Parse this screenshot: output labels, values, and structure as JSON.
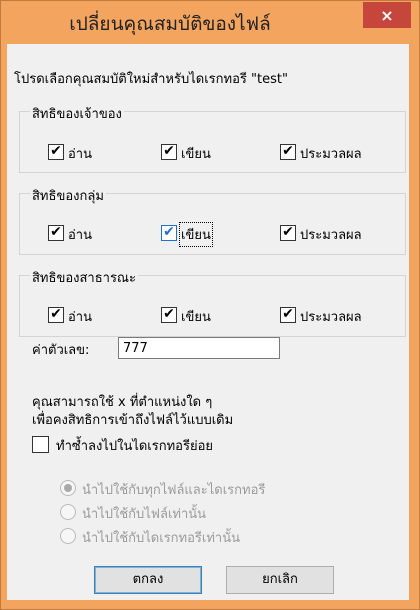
{
  "window": {
    "title": "เปลี่ยนคุณสมบัติของไฟล์",
    "close_icon": "×"
  },
  "prompt": "โปรดเลือกคุณสมบัติใหม่สำหรับไดเรกทอรี \"test\"",
  "groups": [
    {
      "label": "สิทธิของเจ้าของ",
      "read": {
        "label": "อ่าน",
        "checked": true
      },
      "write": {
        "label": "เขียน",
        "checked": true
      },
      "execute": {
        "label": "ประมวลผล",
        "checked": true
      }
    },
    {
      "label": "สิทธิของกลุ่ม",
      "read": {
        "label": "อ่าน",
        "checked": true
      },
      "write": {
        "label": "เขียน",
        "checked": true
      },
      "execute": {
        "label": "ประมวลผล",
        "checked": true
      }
    },
    {
      "label": "สิทธิของสาธารณะ",
      "read": {
        "label": "อ่าน",
        "checked": true
      },
      "write": {
        "label": "เขียน",
        "checked": true
      },
      "execute": {
        "label": "ประมวลผล",
        "checked": true
      }
    }
  ],
  "numeric": {
    "label": "ค่าตัวเลข:",
    "value": "777"
  },
  "hint_line1": "คุณสามารถใช้ x ที่ตำแหน่งใด ๆ",
  "hint_line2": "เพื่อคงสิทธิการเข้าถึงไฟล์ไว้แบบเดิม",
  "recursive": {
    "label": "ทำซ้ำลงไปในไดเรกทอรีย่อย",
    "checked": false
  },
  "apply_options": [
    {
      "label": "นำไปใช้กับทุกไฟล์และไดเรกทอรี",
      "selected": true
    },
    {
      "label": "นำไปใช้กับไฟล์เท่านั้น",
      "selected": false
    },
    {
      "label": "นำไปใช้กับไดเรกทอรีเท่านั้น",
      "selected": false
    }
  ],
  "buttons": {
    "ok": "ตกลง",
    "cancel": "ยกเลิก"
  },
  "checkmark_glyph": "✔",
  "colors": {
    "titlebar": "#f3a560",
    "close": "#c7463b"
  }
}
